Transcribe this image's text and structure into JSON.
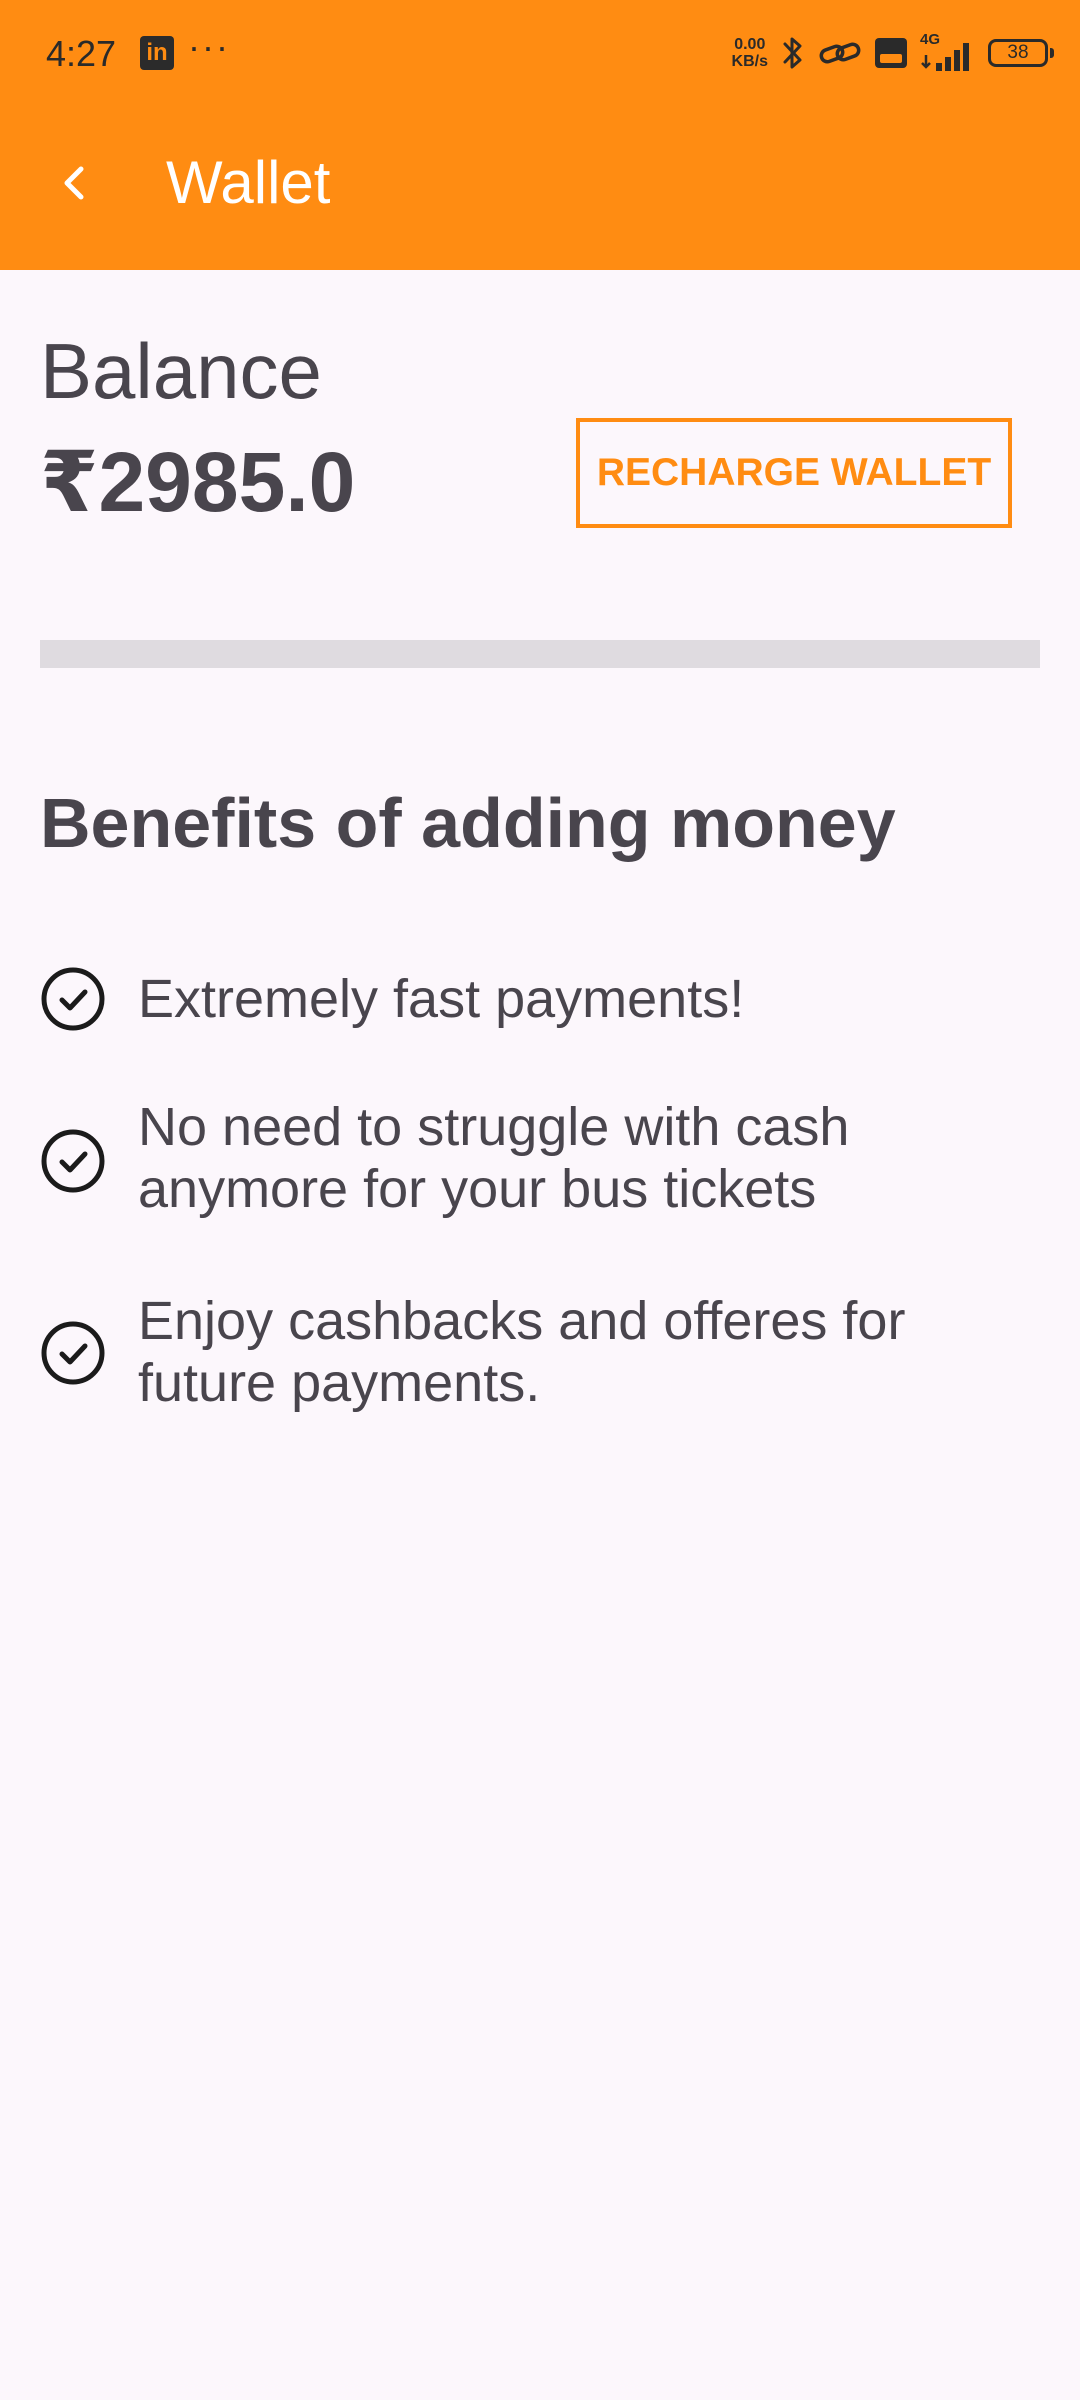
{
  "status_bar": {
    "time": "4:27",
    "app_icon_letters": "in",
    "more": "···",
    "net_speed_value": "0.00",
    "net_speed_unit": "KB/s",
    "network": "4G",
    "battery": "38"
  },
  "header": {
    "title": "Wallet"
  },
  "balance": {
    "label": "Balance",
    "amount": "₹2985.0"
  },
  "recharge_button": {
    "label": "RECHARGE WALLET"
  },
  "benefits": {
    "title": "Benefits of adding money",
    "items": [
      {
        "line1": "Extremely fast payments!",
        "line2": ""
      },
      {
        "line1": "No need to struggle with cash",
        "line2": "anymore for your bus tickets"
      },
      {
        "line1": "Enjoy cashbacks and offeres for",
        "line2": "future payments."
      }
    ]
  },
  "colors": {
    "accent": "#ff8c12",
    "background": "#fcf7fc",
    "text": "#49454d",
    "divider": "#dfdbe0"
  },
  "icons": {
    "back": "chevron-left-icon",
    "check": "check-circle-icon"
  }
}
